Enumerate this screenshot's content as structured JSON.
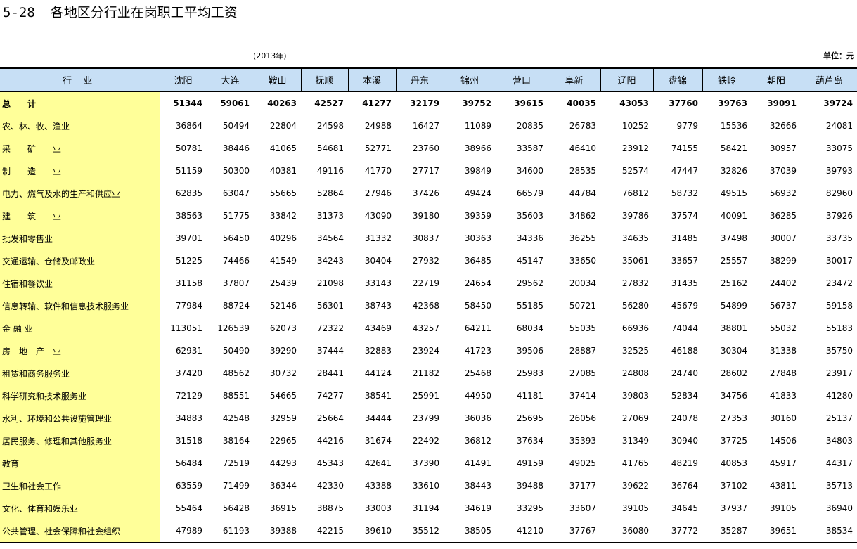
{
  "title": {
    "number": "5-28",
    "text": "各地区分行业在岗职工平均工资"
  },
  "year_note": "(2013年)",
  "unit_note": "单位：元",
  "table": {
    "first_header": "行 业",
    "columns": [
      "沈阳",
      "大连",
      "鞍山",
      "抚顺",
      "本溪",
      "丹东",
      "锦州",
      "营口",
      "阜新",
      "辽阳",
      "盘锦",
      "铁岭",
      "朝阳",
      "葫芦岛"
    ],
    "rows": [
      {
        "name": "总　　计",
        "values": [
          "51344",
          "59061",
          "40263",
          "42527",
          "41277",
          "32179",
          "39752",
          "39615",
          "40035",
          "43053",
          "37760",
          "39763",
          "39091",
          "39724"
        ]
      },
      {
        "name": "农、林、牧、渔业",
        "values": [
          "36864",
          "50494",
          "22804",
          "24598",
          "24988",
          "16427",
          "11089",
          "20835",
          "26783",
          "10252",
          "9779",
          "15536",
          "32666",
          "24081"
        ]
      },
      {
        "name": "采　　矿　　业",
        "values": [
          "50781",
          "38446",
          "41065",
          "54681",
          "52771",
          "23760",
          "38966",
          "33587",
          "46410",
          "23912",
          "74155",
          "58421",
          "30957",
          "33075"
        ]
      },
      {
        "name": "制　　造　　业",
        "values": [
          "51159",
          "50300",
          "40381",
          "49116",
          "41770",
          "27717",
          "39849",
          "34600",
          "28535",
          "52574",
          "47447",
          "32826",
          "37039",
          "39793"
        ]
      },
      {
        "name": "电力、燃气及水的生产和供应业",
        "values": [
          "62835",
          "63047",
          "55665",
          "52864",
          "27946",
          "37426",
          "49424",
          "66579",
          "44784",
          "76812",
          "58732",
          "49515",
          "56932",
          "82960"
        ]
      },
      {
        "name": "建　　筑　　业",
        "values": [
          "38563",
          "51775",
          "33842",
          "31373",
          "43090",
          "39180",
          "39359",
          "35603",
          "34862",
          "39786",
          "37574",
          "40091",
          "36285",
          "37926"
        ]
      },
      {
        "name": "批发和零售业",
        "values": [
          "39701",
          "56450",
          "40296",
          "34564",
          "31332",
          "30837",
          "30363",
          "34336",
          "36255",
          "34635",
          "31485",
          "37498",
          "30007",
          "33735"
        ]
      },
      {
        "name": "交通运输、仓储及邮政业",
        "values": [
          "51225",
          "74466",
          "41549",
          "34243",
          "30404",
          "27932",
          "36485",
          "45147",
          "33650",
          "35061",
          "33657",
          "25557",
          "38299",
          "30017"
        ]
      },
      {
        "name": "住宿和餐饮业",
        "values": [
          "31158",
          "37807",
          "25439",
          "21098",
          "33143",
          "22719",
          "24654",
          "29562",
          "20034",
          "27832",
          "31435",
          "25162",
          "24402",
          "23472"
        ]
      },
      {
        "name": "信息转输、软件和信息技术服务业",
        "values": [
          "77984",
          "88724",
          "52146",
          "56301",
          "38743",
          "42368",
          "58450",
          "55185",
          "50721",
          "56280",
          "45679",
          "54899",
          "56737",
          "59158"
        ]
      },
      {
        "name": "金 融 业",
        "values": [
          "113051",
          "126539",
          "62073",
          "72322",
          "43469",
          "43257",
          "64211",
          "68034",
          "55035",
          "66936",
          "74044",
          "38801",
          "55032",
          "55183"
        ]
      },
      {
        "name": "房　地　产　业",
        "values": [
          "62931",
          "50490",
          "39290",
          "37444",
          "32883",
          "23924",
          "41723",
          "39506",
          "28887",
          "32525",
          "46188",
          "30304",
          "31338",
          "35750"
        ]
      },
      {
        "name": "租赁和商务服务业",
        "values": [
          "37420",
          "48562",
          "30732",
          "28441",
          "44124",
          "21182",
          "25468",
          "25983",
          "27085",
          "24808",
          "24740",
          "28602",
          "27848",
          "23917"
        ]
      },
      {
        "name": "科学研究和技术服务业",
        "values": [
          "72129",
          "88551",
          "54665",
          "74277",
          "38541",
          "25991",
          "44950",
          "41181",
          "37414",
          "39803",
          "52834",
          "34756",
          "41833",
          "41280"
        ]
      },
      {
        "name": "水利、环境和公共设施管理业",
        "values": [
          "34883",
          "42548",
          "32959",
          "25664",
          "34444",
          "23799",
          "36036",
          "25695",
          "26056",
          "27069",
          "24078",
          "27353",
          "30160",
          "25137"
        ]
      },
      {
        "name": "居民服务、修理和其他服务业",
        "values": [
          "31518",
          "38164",
          "22965",
          "44216",
          "31674",
          "22492",
          "36812",
          "37634",
          "35393",
          "31349",
          "30940",
          "37725",
          "14506",
          "34803"
        ]
      },
      {
        "name": "教育",
        "values": [
          "56484",
          "72519",
          "44293",
          "45343",
          "42641",
          "37390",
          "41491",
          "49159",
          "49025",
          "41765",
          "48219",
          "40853",
          "45917",
          "44317"
        ]
      },
      {
        "name": "卫生和社会工作",
        "values": [
          "63559",
          "71499",
          "36344",
          "42330",
          "43388",
          "33610",
          "38443",
          "39488",
          "37177",
          "39622",
          "36764",
          "37102",
          "43811",
          "35713"
        ]
      },
      {
        "name": "文化、体育和娱乐业",
        "values": [
          "55464",
          "56428",
          "36915",
          "38875",
          "33003",
          "31194",
          "34619",
          "33295",
          "33607",
          "39105",
          "34645",
          "37937",
          "39105",
          "36940"
        ]
      },
      {
        "name": "公共管理、社会保障和社会组织",
        "values": [
          "47989",
          "61193",
          "39388",
          "42215",
          "39610",
          "35512",
          "38505",
          "41210",
          "37767",
          "36080",
          "37772",
          "35287",
          "39651",
          "38534"
        ]
      }
    ]
  }
}
